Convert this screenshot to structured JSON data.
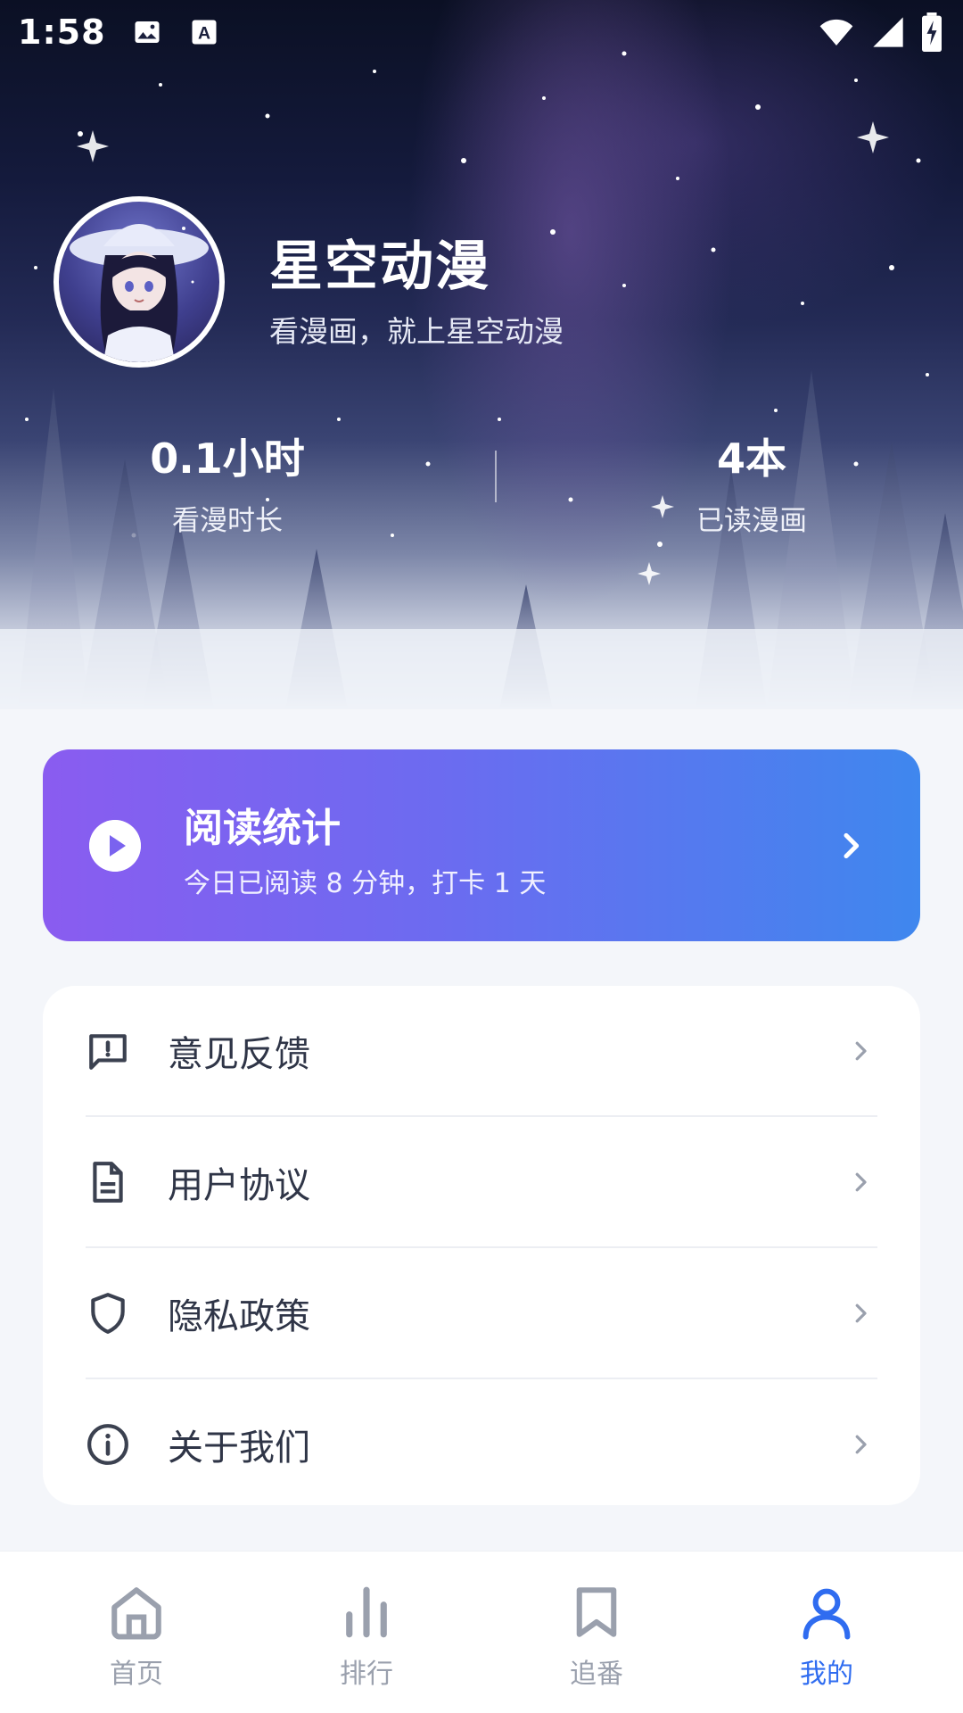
{
  "status_bar": {
    "time": "1:58",
    "icons": [
      "image-icon",
      "font-download-icon",
      "wifi-icon",
      "signal-icon",
      "battery-charging-icon"
    ]
  },
  "profile": {
    "app_name": "星空动漫",
    "tagline": "看漫画，就上星空动漫",
    "avatar": "anime-girl-avatar"
  },
  "stats": {
    "hours_value": "0.1小时",
    "hours_label": "看漫时长",
    "books_value": "4本",
    "books_label": "已读漫画"
  },
  "reading_card": {
    "title": "阅读统计",
    "subtitle": "今日已阅读 8 分钟，打卡 1 天",
    "icon": "play-icon",
    "gradient_start": "#8a5cf0",
    "gradient_end": "#3f87ee"
  },
  "menu": {
    "items": [
      {
        "label": "意见反馈",
        "icon": "feedback-icon"
      },
      {
        "label": "用户协议",
        "icon": "document-icon"
      },
      {
        "label": "隐私政策",
        "icon": "shield-icon"
      },
      {
        "label": "关于我们",
        "icon": "info-icon"
      }
    ]
  },
  "bottom_nav": {
    "items": [
      {
        "label": "首页",
        "icon": "home-icon",
        "active": false
      },
      {
        "label": "排行",
        "icon": "bar-chart-icon",
        "active": false
      },
      {
        "label": "追番",
        "icon": "bookmark-icon",
        "active": false
      },
      {
        "label": "我的",
        "icon": "user-icon",
        "active": true
      }
    ],
    "active_color": "#2f6cf0",
    "inactive_color": "#9aa0ad"
  }
}
